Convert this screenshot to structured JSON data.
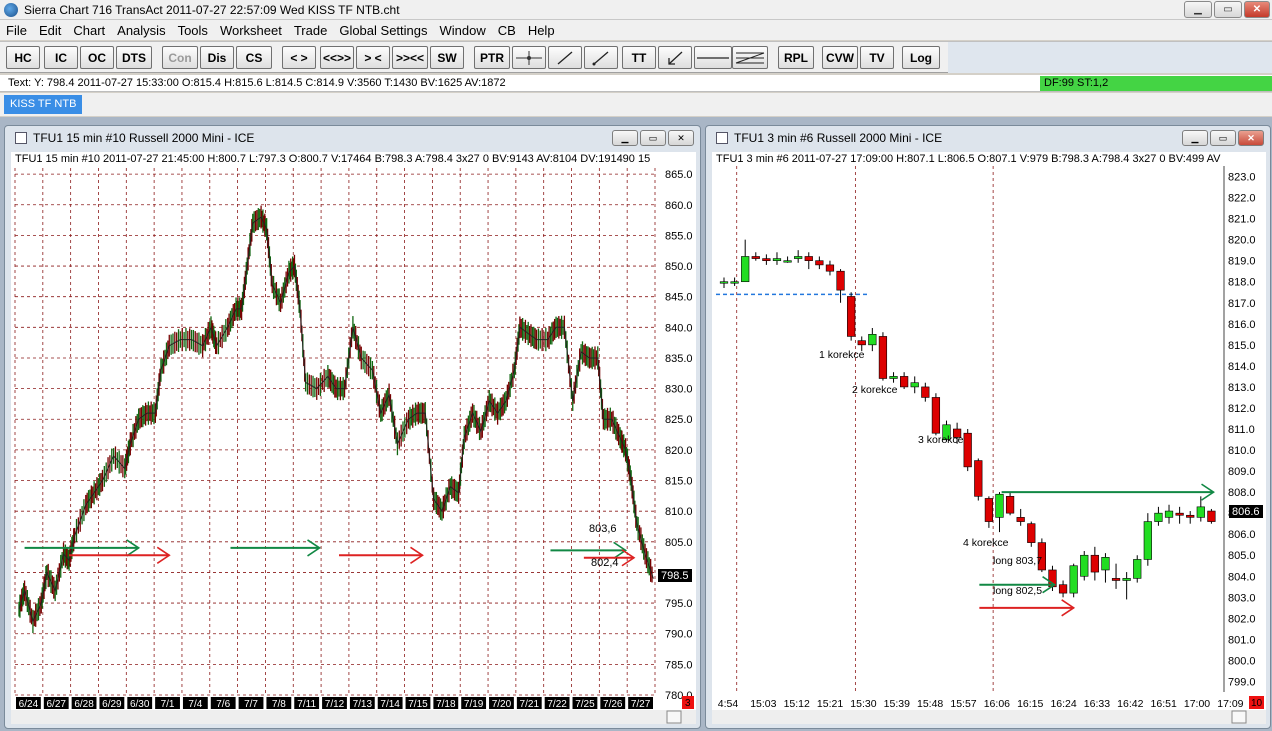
{
  "window": {
    "title": "Sierra Chart 716 TransAct 2011-07-27  22:57:09  Wed   KISS TF NTB.cht"
  },
  "menu": [
    "File",
    "Edit",
    "Chart",
    "Analysis",
    "Tools",
    "Worksheet",
    "Trade",
    "Global Settings",
    "Window",
    "CB",
    "Help"
  ],
  "toolbar": {
    "buttons": [
      {
        "label": "HC",
        "disabled": false
      },
      {
        "label": "IC",
        "disabled": false
      },
      {
        "label": "OC",
        "disabled": false
      },
      {
        "label": "DTS",
        "disabled": false
      },
      {
        "label": "Con",
        "disabled": true
      },
      {
        "label": "Dis",
        "disabled": false
      },
      {
        "label": "CS",
        "disabled": false
      },
      {
        "label": "< >",
        "disabled": false
      },
      {
        "label": "<<>>",
        "disabled": false
      },
      {
        "label": "> <",
        "disabled": false
      },
      {
        "label": ">><<",
        "disabled": false
      },
      {
        "label": "SW",
        "disabled": false
      },
      {
        "label": "PTR",
        "disabled": false
      },
      {
        "label": "TT",
        "disabled": false
      },
      {
        "label": "RPL",
        "disabled": false
      },
      {
        "label": "CVW",
        "disabled": false
      },
      {
        "label": "TV",
        "disabled": false
      },
      {
        "label": "Log",
        "disabled": false
      }
    ],
    "icon_buttons": [
      "crosshair-icon",
      "line-icon",
      "ray-icon",
      "arrow-icon",
      "horizontal-line-icon",
      "fib-icon"
    ]
  },
  "status": {
    "text": "Text: Y: 798.4  2011-07-27  15:33:00  O:815.4  H:815.6  L:814.5  C:814.9  V:3560  T:1430  BV:1625  AV:1872",
    "right": "DF:99  ST:1,2"
  },
  "tab": {
    "label": "KISS TF NTB"
  },
  "colors": {
    "up": "#22dd22",
    "down": "#dd0000",
    "arrow_green": "#118844",
    "arrow_red": "#dd2222",
    "grid": "#8b1a1a",
    "level_line": "#2277dd"
  },
  "chart_left": {
    "window_title": "TFU1  15 min   #10  Russell 2000 Mini - ICE",
    "header": "TFU1  15 min   #10 2011-07-27 21:45:00 H:800.7 L:797.3 O:800.7 V:17464 B:798.3 A:798.4 3x27 0 BV:9143 AV:8104 DV:191490 15",
    "price_label": "798.5",
    "corner_label": "3",
    "annotations": [
      "803,6",
      "802,4"
    ]
  },
  "chart_right": {
    "window_title": "TFU1  3 min   #6  Russell 2000 Mini - ICE",
    "header": "TFU1  3 min   #6 2011-07-27 17:09:00 H:807.1 L:806.5 O:807.1 V:979 B:798.3 A:798.4 3x27 0 BV:499 AV",
    "price_label": "806.6",
    "corner_label": "10",
    "annotations": [
      "1 korekce",
      "2 korekce",
      "3 korekce",
      "4 korekce",
      "long 803,7",
      "long 802,5"
    ]
  },
  "chart_data": [
    {
      "type": "candlestick",
      "title": "TFU1  15 min   #10  Russell 2000 Mini - ICE",
      "ylim": [
        780,
        866
      ],
      "y_ticks": [
        "865.0",
        "860.0",
        "855.0",
        "850.0",
        "845.0",
        "840.0",
        "835.0",
        "830.0",
        "825.0",
        "820.0",
        "815.0",
        "810.0",
        "805.0",
        "800.0",
        "795.0",
        "790.0",
        "785.0",
        "780.0"
      ],
      "x_labels": [
        "6/24",
        "6/27",
        "6/28",
        "6/29",
        "6/30",
        "7/1",
        "7/4",
        "7/6",
        "7/7",
        "7/8",
        "7/11",
        "7/12",
        "7/13",
        "7/14",
        "7/15",
        "7/18",
        "7/19",
        "7/20",
        "7/21",
        "7/22",
        "7/25",
        "7/26",
        "7/27"
      ],
      "daily_close_path": [
        [
          0,
          794
        ],
        [
          0.2,
          797
        ],
        [
          0.5,
          792
        ],
        [
          0.8,
          795
        ],
        [
          1.0,
          800
        ],
        [
          1.3,
          797
        ],
        [
          1.6,
          803
        ],
        [
          1.8,
          802
        ],
        [
          2.0,
          806
        ],
        [
          2.4,
          811
        ],
        [
          2.7,
          813
        ],
        [
          3.0,
          815
        ],
        [
          3.4,
          819
        ],
        [
          3.8,
          817
        ],
        [
          4.0,
          821
        ],
        [
          4.3,
          825
        ],
        [
          4.6,
          826
        ],
        [
          4.9,
          826
        ],
        [
          5.1,
          833
        ],
        [
          5.4,
          837
        ],
        [
          5.8,
          838
        ],
        [
          6.2,
          838
        ],
        [
          6.6,
          837
        ],
        [
          6.9,
          840
        ],
        [
          7.1,
          837
        ],
        [
          7.5,
          840
        ],
        [
          7.8,
          843
        ],
        [
          8.0,
          843
        ],
        [
          8.2,
          850
        ],
        [
          8.4,
          857
        ],
        [
          8.7,
          858
        ],
        [
          8.9,
          856
        ],
        [
          9.1,
          847
        ],
        [
          9.4,
          844
        ],
        [
          9.7,
          849
        ],
        [
          9.9,
          850
        ],
        [
          10.1,
          843
        ],
        [
          10.3,
          831
        ],
        [
          10.7,
          830
        ],
        [
          11.1,
          832
        ],
        [
          11.4,
          830
        ],
        [
          11.7,
          830
        ],
        [
          12.0,
          840
        ],
        [
          12.3,
          835
        ],
        [
          12.7,
          833
        ],
        [
          13.0,
          826
        ],
        [
          13.3,
          829
        ],
        [
          13.6,
          821
        ],
        [
          14.0,
          825
        ],
        [
          14.3,
          826
        ],
        [
          14.6,
          826
        ],
        [
          14.9,
          812
        ],
        [
          15.2,
          810
        ],
        [
          15.5,
          814
        ],
        [
          15.8,
          813
        ],
        [
          16.0,
          822
        ],
        [
          16.3,
          826
        ],
        [
          16.6,
          823
        ],
        [
          16.9,
          828
        ],
        [
          17.2,
          826
        ],
        [
          17.5,
          828
        ],
        [
          17.8,
          833
        ],
        [
          18.0,
          840
        ],
        [
          18.3,
          839
        ],
        [
          18.6,
          838
        ],
        [
          19.0,
          838
        ],
        [
          19.3,
          840
        ],
        [
          19.6,
          840
        ],
        [
          19.9,
          828
        ],
        [
          20.2,
          836
        ],
        [
          20.5,
          835
        ],
        [
          20.8,
          835
        ],
        [
          21.0,
          825
        ],
        [
          21.3,
          825
        ],
        [
          21.6,
          822
        ],
        [
          21.8,
          820
        ],
        [
          22.0,
          815
        ],
        [
          22.2,
          808
        ],
        [
          22.5,
          803
        ],
        [
          22.8,
          799
        ]
      ],
      "arrows": [
        {
          "color": "green",
          "x1": 0.2,
          "x2": 4.3,
          "y": 804.0
        },
        {
          "color": "red",
          "x1": 1.8,
          "x2": 5.4,
          "y": 802.8
        },
        {
          "color": "green",
          "x1": 7.6,
          "x2": 10.8,
          "y": 804.0
        },
        {
          "color": "red",
          "x1": 11.5,
          "x2": 14.5,
          "y": 802.8
        },
        {
          "color": "green",
          "x1": 19.1,
          "x2": 21.8,
          "y": 803.6
        },
        {
          "color": "red",
          "x1": 20.3,
          "x2": 22.1,
          "y": 802.4
        }
      ]
    },
    {
      "type": "candlestick",
      "title": "TFU1  3 min   #6  Russell 2000 Mini - ICE",
      "ylim": [
        798.5,
        823.5
      ],
      "y_ticks": [
        "823.0",
        "822.0",
        "821.0",
        "820.0",
        "819.0",
        "818.0",
        "817.0",
        "816.0",
        "815.0",
        "814.0",
        "813.0",
        "812.0",
        "811.0",
        "810.0",
        "809.0",
        "808.0",
        "807.0",
        "806.0",
        "805.0",
        "804.0",
        "803.0",
        "802.0",
        "801.0",
        "800.0",
        "799.0"
      ],
      "x_labels": [
        "4:54",
        "15:03",
        "15:12",
        "15:21",
        "15:30",
        "15:39",
        "15:48",
        "15:57",
        "16:06",
        "16:15",
        "16:24",
        "16:33",
        "16:42",
        "16:51",
        "17:00",
        "17:09"
      ],
      "candles": [
        [
          818,
          818.2,
          817.7,
          818.0
        ],
        [
          818,
          818.2,
          817.8,
          818.0
        ],
        [
          818.0,
          820.0,
          818.0,
          819.2
        ],
        [
          819.2,
          819.4,
          819.0,
          819.1
        ],
        [
          819.1,
          819.3,
          818.8,
          819.0
        ],
        [
          819.0,
          819.4,
          818.8,
          819.1
        ],
        [
          819.0,
          819.2,
          818.9,
          819.0
        ],
        [
          819.1,
          819.5,
          818.9,
          819.2
        ],
        [
          819.2,
          819.4,
          818.6,
          819.0
        ],
        [
          819.0,
          819.2,
          818.6,
          818.8
        ],
        [
          818.8,
          819.0,
          818.3,
          818.5
        ],
        [
          818.5,
          818.6,
          817.0,
          817.6
        ],
        [
          817.3,
          817.5,
          815.2,
          815.4
        ],
        [
          815.2,
          815.4,
          814.7,
          815.0
        ],
        [
          815.0,
          815.8,
          814.7,
          815.5
        ],
        [
          815.4,
          815.6,
          813.3,
          813.4
        ],
        [
          813.4,
          813.7,
          813.2,
          813.5
        ],
        [
          813.5,
          813.7,
          812.9,
          813.0
        ],
        [
          813.0,
          813.5,
          812.7,
          813.2
        ],
        [
          813.0,
          813.2,
          812.3,
          812.5
        ],
        [
          812.5,
          812.7,
          810.7,
          810.8
        ],
        [
          810.5,
          811.4,
          810.4,
          811.2
        ],
        [
          811.0,
          811.3,
          810.3,
          810.6
        ],
        [
          810.8,
          811.0,
          809.0,
          809.2
        ],
        [
          809.5,
          809.6,
          807.6,
          807.8
        ],
        [
          807.7,
          807.8,
          806.3,
          806.6
        ],
        [
          806.8,
          808.0,
          806.1,
          807.9
        ],
        [
          807.8,
          808.0,
          806.9,
          807.0
        ],
        [
          806.8,
          807.2,
          806.4,
          806.6
        ],
        [
          806.5,
          806.6,
          805.4,
          805.6
        ],
        [
          805.6,
          805.8,
          804.2,
          804.3
        ],
        [
          804.3,
          804.5,
          803.3,
          803.5
        ],
        [
          803.6,
          803.8,
          803.0,
          803.2
        ],
        [
          803.2,
          804.6,
          803.0,
          804.5
        ],
        [
          804.0,
          805.2,
          803.8,
          805.0
        ],
        [
          805.0,
          805.4,
          803.8,
          804.2
        ],
        [
          804.3,
          805.1,
          803.7,
          804.9
        ],
        [
          803.9,
          804.6,
          803.4,
          803.8
        ],
        [
          803.8,
          804.2,
          802.9,
          803.9
        ],
        [
          803.9,
          805.0,
          803.7,
          804.8
        ],
        [
          804.8,
          807.0,
          804.5,
          806.6
        ],
        [
          806.6,
          807.3,
          806.4,
          807.0
        ],
        [
          806.8,
          807.4,
          806.5,
          807.1
        ],
        [
          807.0,
          807.3,
          806.5,
          806.9
        ],
        [
          806.9,
          807.1,
          806.5,
          806.8
        ],
        [
          806.8,
          807.8,
          806.6,
          807.3
        ],
        [
          807.1,
          807.2,
          806.5,
          806.6
        ]
      ],
      "level_line": {
        "y": 817.4,
        "from": 0,
        "to": 13.5
      },
      "arrows": [
        {
          "color": "green",
          "x1": 26.2,
          "x2": 46.2,
          "y": 808.0
        },
        {
          "color": "green",
          "x1": 24.1,
          "x2": 31.2,
          "y": 803.6
        },
        {
          "color": "red",
          "x1": 24.1,
          "x2": 33.0,
          "y": 802.5
        }
      ]
    }
  ]
}
